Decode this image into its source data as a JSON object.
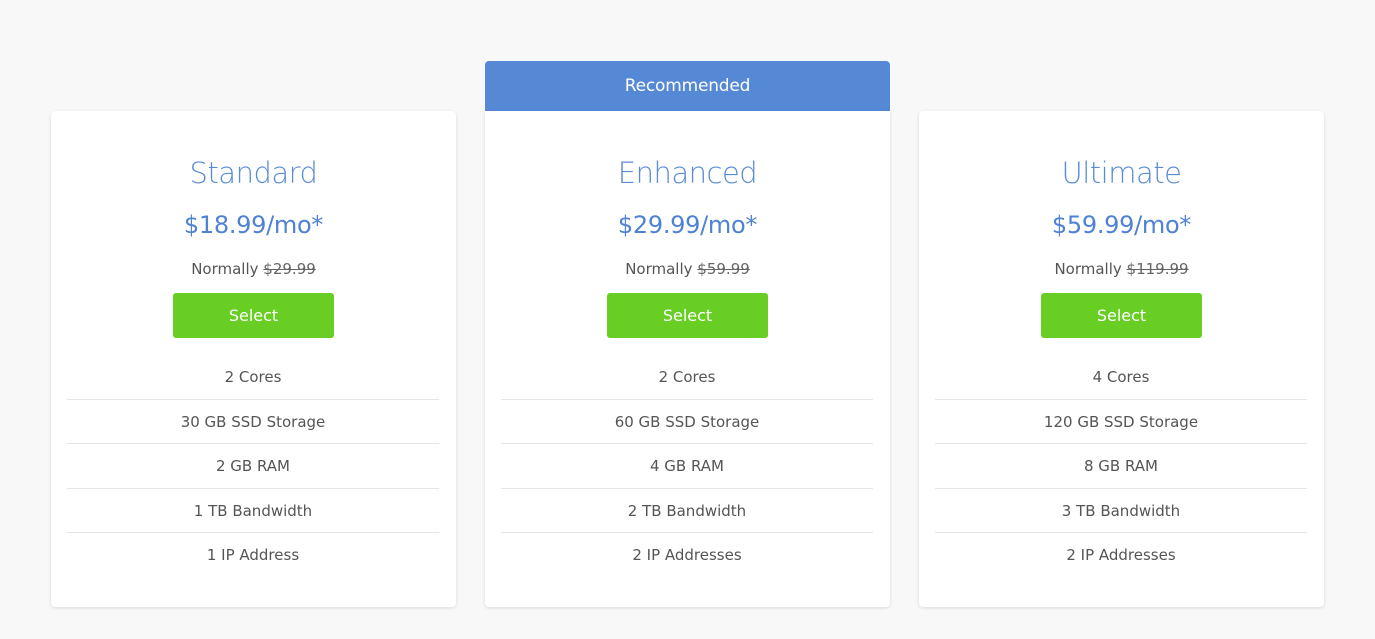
{
  "banner": {
    "label": "Recommended"
  },
  "plans": [
    {
      "name": "Standard",
      "price": "$18.99/mo*",
      "normally_label": "Normally ",
      "normally_price": "$29.99",
      "select_label": "Select",
      "features": [
        "2 Cores",
        "30 GB SSD Storage",
        "2 GB RAM",
        "1 TB Bandwidth",
        "1 IP Address"
      ]
    },
    {
      "name": "Enhanced",
      "price": "$29.99/mo*",
      "normally_label": "Normally ",
      "normally_price": "$59.99",
      "select_label": "Select",
      "features": [
        "2 Cores",
        "60 GB SSD Storage",
        "4 GB RAM",
        "2 TB Bandwidth",
        "2 IP Addresses"
      ]
    },
    {
      "name": "Ultimate",
      "price": "$59.99/mo*",
      "normally_label": "Normally ",
      "normally_price": "$119.99",
      "select_label": "Select",
      "features": [
        "4 Cores",
        "120 GB SSD Storage",
        "8 GB RAM",
        "3 TB Bandwidth",
        "2 IP Addresses"
      ]
    }
  ],
  "colors": {
    "accent": "#5589d6",
    "plan_title": "#5a8bd5",
    "button": "#68ce24",
    "background": "#f8f8f8"
  }
}
